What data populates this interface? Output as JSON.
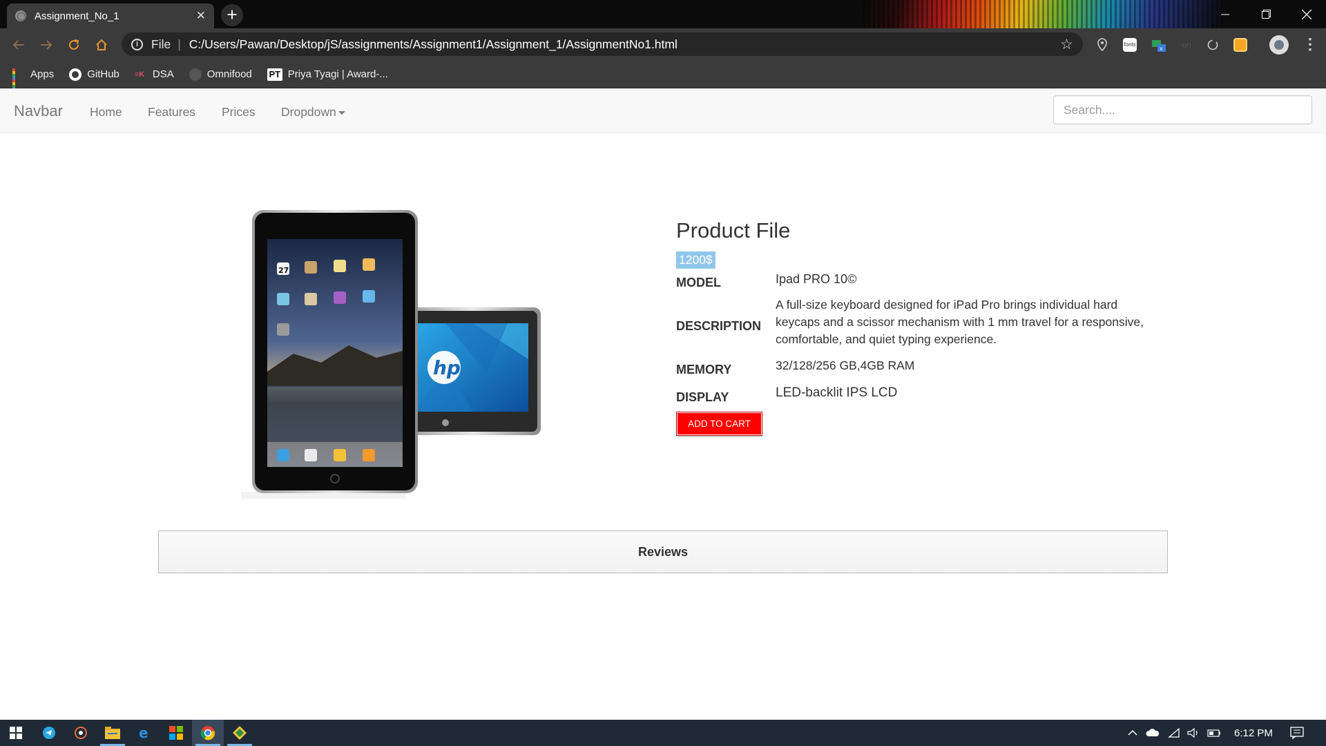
{
  "browser": {
    "tab_title": "Assignment_No_1",
    "tab_close_icon": "✕",
    "new_tab_icon": "+",
    "address_scheme": "File",
    "address_url": "C:/Users/Pawan/Desktop/jS/assignments/Assignment1/Assignment_1/AssignmentNo1.html",
    "bookmarks": [
      {
        "label": "Apps",
        "icon": "apps-grid-icon"
      },
      {
        "label": "GitHub",
        "icon": "github-icon"
      },
      {
        "label": "DSA",
        "icon": "dsa-icon"
      },
      {
        "label": "Omnifood",
        "icon": "omnifood-icon"
      },
      {
        "label": "Priya Tyagi | Award-...",
        "icon": "pt-icon"
      }
    ],
    "extension_fonts_label": "fonts",
    "pt_glyph": "PT"
  },
  "site_nav": {
    "brand": "Navbar",
    "links": [
      "Home",
      "Features",
      "Prices",
      "Dropdown"
    ],
    "search_placeholder": "Search...."
  },
  "product": {
    "title": "Product File",
    "price": "1200$",
    "specs": [
      {
        "label": "MODEL",
        "value": "Ipad PRO 10©"
      },
      {
        "label": "DESCRIPTION",
        "value": "A full-size keyboard designed for iPad Pro brings individual hard keycaps and a scissor mechanism with 1 mm travel for a responsive, comfortable, and quiet typing experience."
      },
      {
        "label": "MEMORY",
        "value": "32/128/256 GB,4GB RAM"
      },
      {
        "label": "DISPLAY",
        "value": "LED-backlit IPS LCD"
      }
    ],
    "add_to_cart": "ADD TO CART",
    "reviews_label": "Reviews",
    "ipad_calendar_day": "27",
    "hp_logo": "hp"
  },
  "taskbar": {
    "clock": "6:12 PM"
  },
  "colors": {
    "add_to_cart_bg": "#ff0000",
    "price_highlight": "#8fc7ea",
    "chrome_dark": "#3b3b3b",
    "taskbar_bg": "#1f2a36"
  }
}
